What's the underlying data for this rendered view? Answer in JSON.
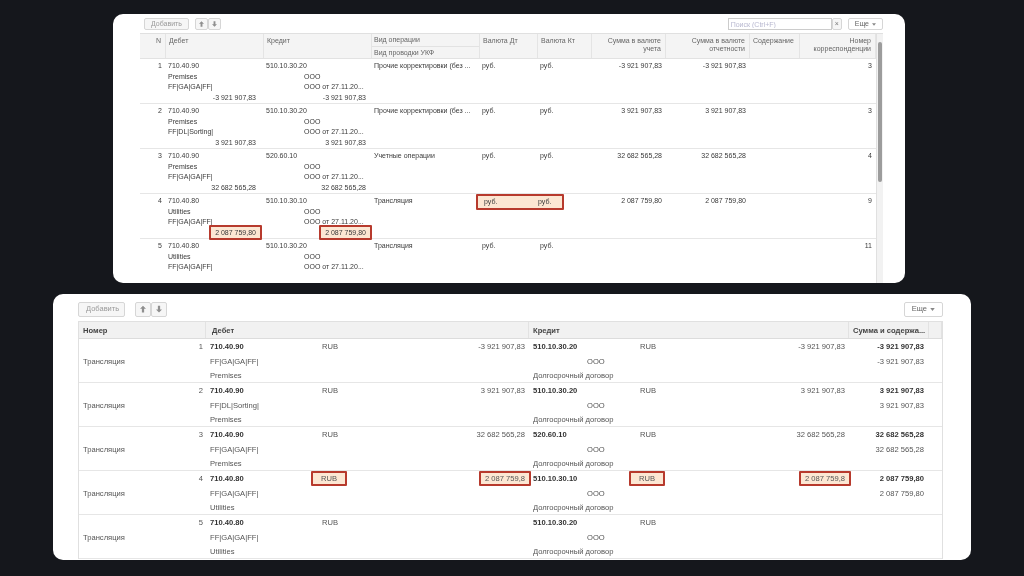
{
  "top_panel": {
    "toolbar": {
      "add_button": "Добавить",
      "search_placeholder": "Поиск (Ctrl+F)",
      "clear_button": "×",
      "more_button": "Еще"
    },
    "columns": [
      "N",
      "Дебет",
      "Кредит",
      "Вид операции",
      "Валюта Дт",
      "Валюта Кт",
      "Сумма в валюте учета",
      "Сумма в валюте отчетности",
      "Содержание",
      "Номер корреспонденции"
    ],
    "operation_subheader": "Вид проводки УКФ",
    "rows": [
      {
        "n": "1",
        "debit": {
          "account": "710.40.90",
          "lines": [
            "Premises",
            "FF|GA|GA|FF|"
          ],
          "amount": "-3 921 907,83",
          "highlighted": false
        },
        "credit": {
          "account": "510.10.30.20",
          "lines": [
            "ООО",
            "ООО от 27.11.20..."
          ],
          "amount": "-3 921 907,83",
          "highlighted": false
        },
        "operation": "Прочие корректировки (без ...",
        "currency_dt": "руб.",
        "currency_kt": "руб.",
        "currency_highlighted": false,
        "sum_accounting": "-3 921 907,83",
        "sum_reporting": "-3 921 907,83",
        "corr_no": "3"
      },
      {
        "n": "2",
        "debit": {
          "account": "710.40.90",
          "lines": [
            "Premises",
            "FF|DL|Sorting|"
          ],
          "amount": "3 921 907,83",
          "highlighted": false
        },
        "credit": {
          "account": "510.10.30.20",
          "lines": [
            "ООО",
            "ООО от 27.11.20..."
          ],
          "amount": "3 921 907,83",
          "highlighted": false
        },
        "operation": "Прочие корректировки (без ...",
        "currency_dt": "руб.",
        "currency_kt": "руб.",
        "currency_highlighted": false,
        "sum_accounting": "3 921 907,83",
        "sum_reporting": "3 921 907,83",
        "corr_no": "3"
      },
      {
        "n": "3",
        "debit": {
          "account": "710.40.90",
          "lines": [
            "Premises",
            "FF|GA|GA|FF|"
          ],
          "amount": "32 682 565,28",
          "highlighted": false
        },
        "credit": {
          "account": "520.60.10",
          "lines": [
            "ООО",
            "ООО от 27.11.20..."
          ],
          "amount": "32 682 565,28",
          "highlighted": false
        },
        "operation": "Учетные операции",
        "currency_dt": "руб.",
        "currency_kt": "руб.",
        "currency_highlighted": false,
        "sum_accounting": "32 682 565,28",
        "sum_reporting": "32 682 565,28",
        "corr_no": "4"
      },
      {
        "n": "4",
        "debit": {
          "account": "710.40.80",
          "lines": [
            "Utilities",
            "FF|GA|GA|FF|"
          ],
          "amount": "2 087 759,80",
          "highlighted": true
        },
        "credit": {
          "account": "510.10.30.10",
          "lines": [
            "ООО",
            "ООО от 27.11.20..."
          ],
          "amount": "2 087 759,80",
          "highlighted": true
        },
        "operation": "Трансляция",
        "currency_dt": "руб.",
        "currency_kt": "руб.",
        "currency_highlighted": true,
        "sum_accounting": "2 087 759,80",
        "sum_reporting": "2 087 759,80",
        "corr_no": "9"
      },
      {
        "n": "5",
        "debit": {
          "account": "710.40.80",
          "lines": [
            "Utilities",
            "FF|GA|GA|FF|"
          ]
        },
        "credit": {
          "account": "510.10.30.20",
          "lines": [
            "ООО",
            "ООО от 27.11.20..."
          ]
        },
        "operation": "Трансляция",
        "currency_dt": "руб.",
        "currency_kt": "руб.",
        "currency_highlighted": false,
        "corr_no": "11"
      }
    ]
  },
  "bottom_panel": {
    "toolbar": {
      "add_button": "Добавить",
      "more_button": "Еще"
    },
    "columns": [
      "Номер",
      "Дебет",
      "Кредит",
      "Сумма и содержа..."
    ],
    "rows": [
      {
        "n": "1",
        "operation": "Трансляция",
        "debit": {
          "account": "710.40.90",
          "currency": "RUB",
          "amount": "-3 921 907,83",
          "lines": [
            "FF|GA|GA|FF|",
            "Premises"
          ],
          "currency_highlighted": false,
          "amount_highlighted": false
        },
        "credit": {
          "account": "510.10.30.20",
          "currency": "RUB",
          "amount": "-3 921 907,83",
          "lines": [
            "ООО",
            "Долгосрочный договор"
          ],
          "currency_highlighted": false,
          "amount_highlighted": false
        },
        "sum": "-3 921 907,83",
        "sum_2": "-3 921 907,83"
      },
      {
        "n": "2",
        "operation": "Трансляция",
        "debit": {
          "account": "710.40.90",
          "currency": "RUB",
          "amount": "3 921 907,83",
          "lines": [
            "FF|DL|Sorting|",
            "Premises"
          ],
          "currency_highlighted": false,
          "amount_highlighted": false
        },
        "credit": {
          "account": "510.10.30.20",
          "currency": "RUB",
          "amount": "3 921 907,83",
          "lines": [
            "ООО",
            "Долгосрочный договор"
          ],
          "currency_highlighted": false,
          "amount_highlighted": false
        },
        "sum": "3 921 907,83",
        "sum_2": "3 921 907,83"
      },
      {
        "n": "3",
        "operation": "Трансляция",
        "debit": {
          "account": "710.40.90",
          "currency": "RUB",
          "amount": "32 682 565,28",
          "lines": [
            "FF|GA|GA|FF|",
            "Premises"
          ],
          "currency_highlighted": false,
          "amount_highlighted": false
        },
        "credit": {
          "account": "520.60.10",
          "currency": "RUB",
          "amount": "32 682 565,28",
          "lines": [
            "ООО",
            "Долгосрочный договор"
          ],
          "currency_highlighted": false,
          "amount_highlighted": false
        },
        "sum": "32 682 565,28",
        "sum_2": "32 682 565,28"
      },
      {
        "n": "4",
        "operation": "Трансляция",
        "debit": {
          "account": "710.40.80",
          "currency": "RUB",
          "amount": "2 087 759,8",
          "lines": [
            "FF|GA|GA|FF|",
            "Utilities"
          ],
          "currency_highlighted": true,
          "amount_highlighted": true
        },
        "credit": {
          "account": "510.10.30.10",
          "currency": "RUB",
          "amount": "2 087 759,8",
          "lines": [
            "ООО",
            "Долгосрочный договор"
          ],
          "currency_highlighted": true,
          "amount_highlighted": true
        },
        "sum": "2 087 759,80",
        "sum_2": "2 087 759,80"
      },
      {
        "n": "5",
        "operation": "Трансляция",
        "debit": {
          "account": "710.40.80",
          "currency": "RUB",
          "lines": [
            "FF|GA|GA|FF|",
            "Utilities"
          ],
          "currency_highlighted": false
        },
        "credit": {
          "account": "510.10.30.20",
          "currency": "RUB",
          "lines": [
            "ООО",
            "Долгосрочный договор"
          ],
          "currency_highlighted": false
        }
      }
    ]
  }
}
